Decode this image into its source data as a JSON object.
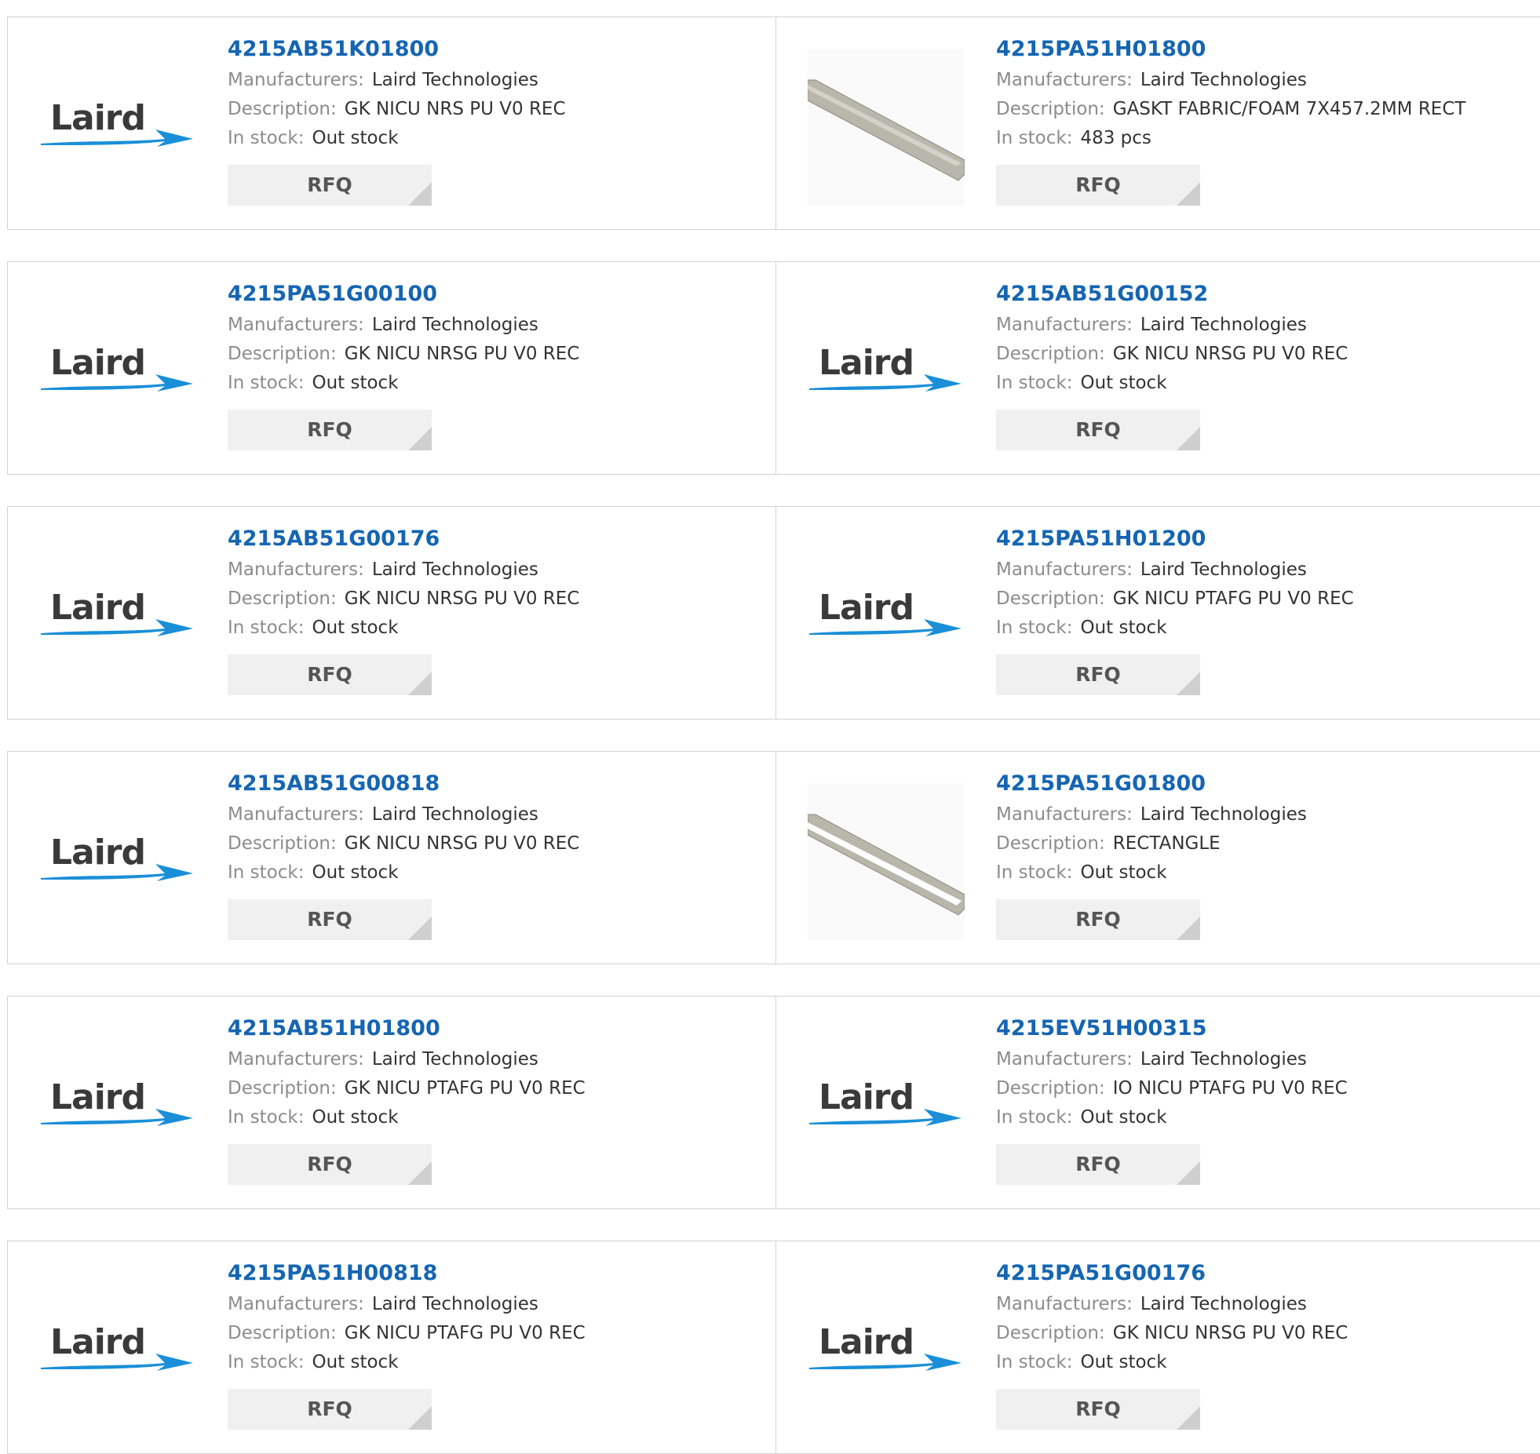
{
  "products": [
    {
      "part": "4215AB51K01800",
      "manufacturer": "Laird Technologies",
      "description": "GK NICU NRS PU V0 REC",
      "stock": "Out stock",
      "image": "laird-logo"
    },
    {
      "part": "4215PA51H01800",
      "manufacturer": "Laird Technologies",
      "description": "GASKT FABRIC/FOAM 7X457.2MM RECT",
      "stock": "483 pcs",
      "image": "gasket-strip-photo"
    },
    {
      "part": "4215PA51G00100",
      "manufacturer": "Laird Technologies",
      "description": "GK NICU NRSG PU V0 REC",
      "stock": "Out stock",
      "image": "laird-logo"
    },
    {
      "part": "4215AB51G00152",
      "manufacturer": "Laird Technologies",
      "description": "GK NICU NRSG PU V0 REC",
      "stock": "Out stock",
      "image": "laird-logo"
    },
    {
      "part": "4215AB51G00176",
      "manufacturer": "Laird Technologies",
      "description": "GK NICU NRSG PU V0 REC",
      "stock": "Out stock",
      "image": "laird-logo"
    },
    {
      "part": "4215PA51H01200",
      "manufacturer": "Laird Technologies",
      "description": "GK NICU PTAFG PU V0 REC",
      "stock": "Out stock",
      "image": "laird-logo"
    },
    {
      "part": "4215AB51G00818",
      "manufacturer": "Laird Technologies",
      "description": "GK NICU NRSG PU V0 REC",
      "stock": "Out stock",
      "image": "laird-logo"
    },
    {
      "part": "4215PA51G01800",
      "manufacturer": "Laird Technologies",
      "description": "RECTANGLE",
      "stock": "Out stock",
      "image": "gasket-strip-photo-white"
    },
    {
      "part": "4215AB51H01800",
      "manufacturer": "Laird Technologies",
      "description": "GK NICU PTAFG PU V0 REC",
      "stock": "Out stock",
      "image": "laird-logo"
    },
    {
      "part": "4215EV51H00315",
      "manufacturer": "Laird Technologies",
      "description": "IO NICU PTAFG PU V0 REC",
      "stock": "Out stock",
      "image": "laird-logo"
    },
    {
      "part": "4215PA51H00818",
      "manufacturer": "Laird Technologies",
      "description": "GK NICU PTAFG PU V0 REC",
      "stock": "Out stock",
      "image": "laird-logo"
    },
    {
      "part": "4215PA51G00176",
      "manufacturer": "Laird Technologies",
      "description": "GK NICU NRSG PU V0 REC",
      "stock": "Out stock",
      "image": "laird-logo"
    }
  ],
  "labels": {
    "manufacturers": "Manufacturers:",
    "description": "Description:",
    "in_stock": "In stock:",
    "rfq": "RFQ"
  },
  "logo_text": "Laird",
  "colors": {
    "part_link": "#1565b2",
    "label": "#8c8c8c",
    "value": "#333333",
    "rfq_bg": "#f0f0f0",
    "border": "#d3d3d3",
    "logo_swoosh": "#1a8fd8"
  }
}
